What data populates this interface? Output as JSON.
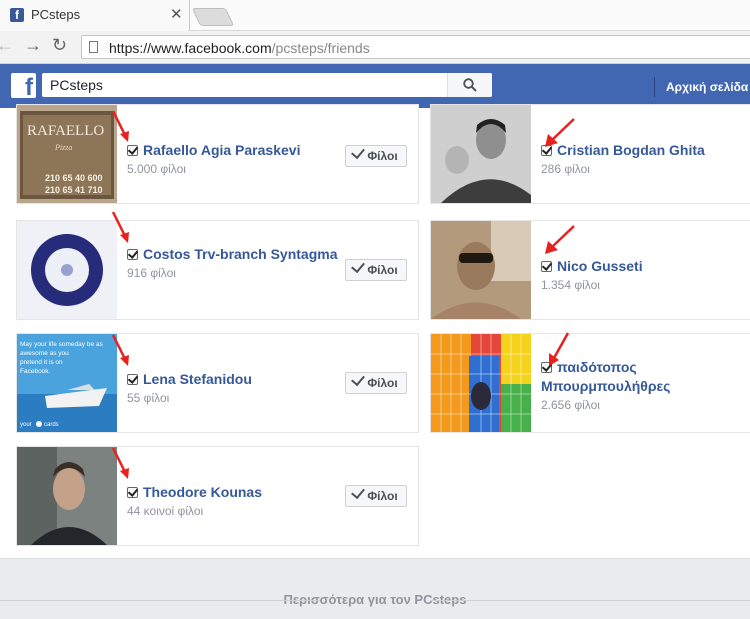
{
  "browser": {
    "tab_title": "PCsteps",
    "url_host": "https://www.facebook.com",
    "url_path": "/pcsteps/friends"
  },
  "fb": {
    "search_value": "PCsteps",
    "home_label": "Αρχική σελίδα"
  },
  "friends_button_label": "Φίλοι",
  "friends_left": [
    {
      "name": "Rafaello Agia Paraskevi",
      "sub": "5.000 φίλοι",
      "image": "rafaello-pizza-sign"
    },
    {
      "name": "Costos Trv-branch Syntagma",
      "sub": "916 φίλοι",
      "image": "blue-ring-logo"
    },
    {
      "name": "Lena Stefanidou",
      "sub": "55 φίλοι",
      "image": "boat-quote-card"
    },
    {
      "name": "Theodore Kounas",
      "sub": "44 κοινοί φίλοι",
      "image": "man-portrait"
    }
  ],
  "friends_right": [
    {
      "name": "Cristian Bogdan Ghita",
      "sub": "286 φίλοι",
      "image": "man-with-child"
    },
    {
      "name": "Nico Gusseti",
      "sub": "1.354 φίλοι",
      "image": "sepia-selfie"
    },
    {
      "name": "παιδότοπος Μπουρμπουλήθρες",
      "sub": "2.656 φίλοι",
      "image": "playground"
    }
  ],
  "rafaello_sign_text": [
    "RAFAELLO",
    "Pizza",
    "210 65 40 600",
    "210 65 41 710"
  ],
  "lena_card_text": [
    "May your life someday be as",
    "awesome as you",
    "pretend it is on",
    "Facebook.",
    "your",
    "cards"
  ],
  "footer": {
    "more_label": "Περισσότερα για τον PCsteps"
  },
  "colors": {
    "fb_blue": "#4267b2",
    "link": "#365899",
    "arrow": "#e8201e"
  }
}
